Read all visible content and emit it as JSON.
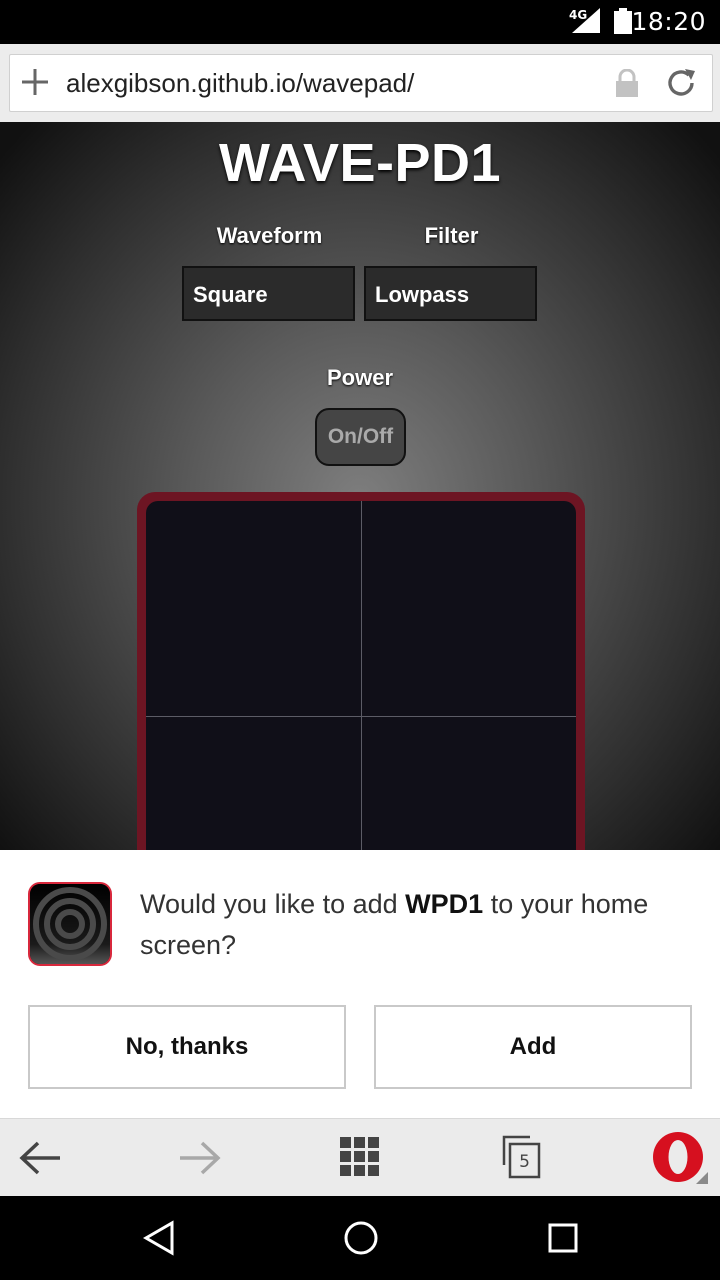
{
  "status_bar": {
    "network": "4G",
    "time": "18:20"
  },
  "address_bar": {
    "url": "alexgibson.github.io/wavepad/",
    "icons": [
      "plus-icon",
      "lock-icon",
      "reload-icon"
    ]
  },
  "page": {
    "title": "WAVE-PD1",
    "waveform_label": "Waveform",
    "waveform_value": "Square",
    "filter_label": "Filter",
    "filter_value": "Lowpass",
    "power_label": "Power",
    "power_button": "On/Off"
  },
  "install_prompt": {
    "text_before": "Would you like to add ",
    "app_name": "WPD1",
    "text_after": " to your home screen?",
    "no_button": "No, thanks",
    "add_button": "Add"
  },
  "toolbar": {
    "tab_count": "5",
    "icons": [
      "back-arrow-icon",
      "forward-arrow-icon",
      "speed-dial-grid-icon",
      "tabs-icon",
      "opera-menu-icon"
    ]
  },
  "colors": {
    "pad_border": "#6d1523",
    "pad_bg": "#100f18",
    "opera_red": "#d6101f"
  }
}
